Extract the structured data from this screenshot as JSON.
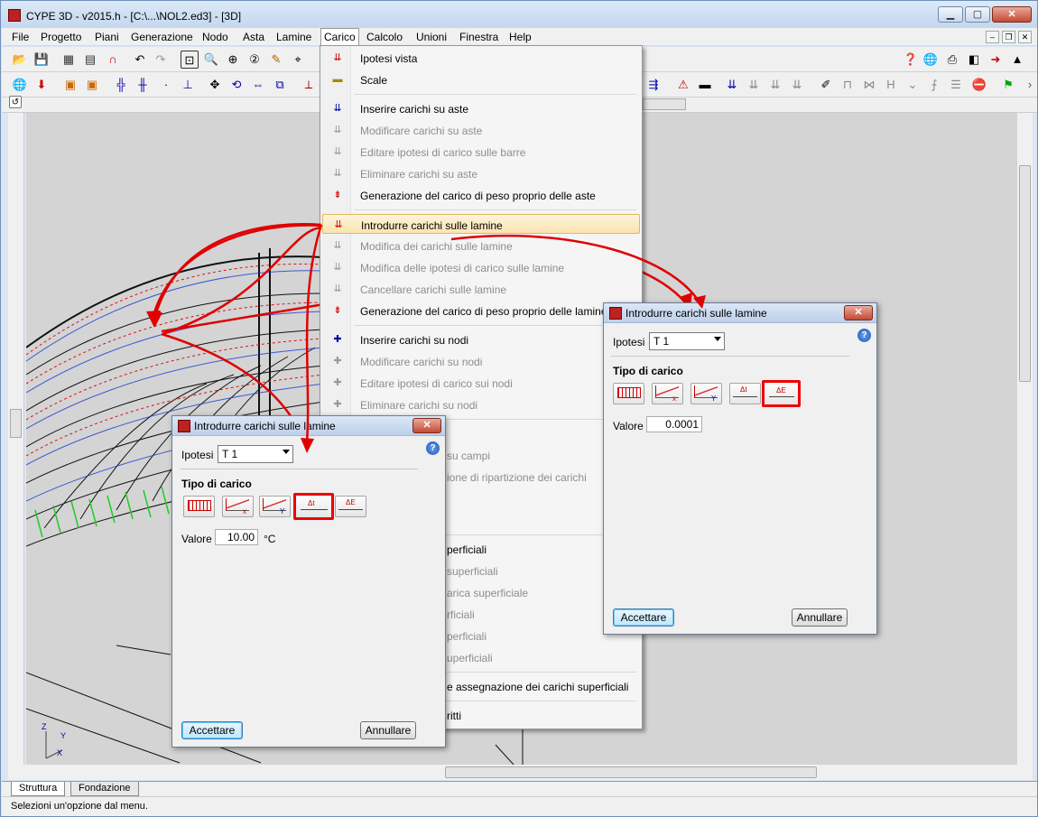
{
  "window": {
    "title": "CYPE 3D - v2015.h - [C:\\...\\NOL2.ed3] - [3D]"
  },
  "menubar": [
    {
      "label": "File"
    },
    {
      "label": "Progetto"
    },
    {
      "label": "Piani"
    },
    {
      "label": "Generazione"
    },
    {
      "label": "Nodo"
    },
    {
      "label": "Asta"
    },
    {
      "label": "Lamine"
    },
    {
      "label": "Carico"
    },
    {
      "label": "Calcolo"
    },
    {
      "label": "Unioni"
    },
    {
      "label": "Finestra"
    },
    {
      "label": "Help"
    }
  ],
  "dropdown": {
    "items": [
      {
        "label": "Ipotesi vista",
        "enabled": true
      },
      {
        "label": "Scale",
        "enabled": true
      },
      {
        "label": "Inserire carichi su aste",
        "enabled": true
      },
      {
        "label": "Modificare carichi su aste",
        "enabled": false
      },
      {
        "label": "Editare ipotesi di carico sulle barre",
        "enabled": false
      },
      {
        "label": "Eliminare carichi su aste",
        "enabled": false
      },
      {
        "label": "Generazione del carico di peso proprio delle aste",
        "enabled": true
      },
      {
        "label": "Introdurre carichi sulle lamine",
        "enabled": true
      },
      {
        "label": "Modifica dei carichi sulle lamine",
        "enabled": false
      },
      {
        "label": "Modifica delle ipotesi di carico sulle lamine",
        "enabled": false
      },
      {
        "label": "Cancellare carichi sulle lamine",
        "enabled": false
      },
      {
        "label": "Generazione del carico di peso proprio delle lamine",
        "enabled": true
      },
      {
        "label": "Inserire carichi su nodi",
        "enabled": true
      },
      {
        "label": "Modificare carichi su nodi",
        "enabled": false
      },
      {
        "label": "Editare ipotesi di carico sui nodi",
        "enabled": false
      },
      {
        "label": "Eliminare carichi su nodi",
        "enabled": false
      },
      {
        "label": "su campi",
        "enabled": false
      },
      {
        "label": "ione di ripartizione dei carichi",
        "enabled": false
      },
      {
        "label": "perficiali",
        "enabled": true
      },
      {
        "label": "superficiali",
        "enabled": false
      },
      {
        "label": "arica superficiale",
        "enabled": false
      },
      {
        "label": "rficiali",
        "enabled": false
      },
      {
        "label": "perficiali",
        "enabled": false
      },
      {
        "label": "uperficiali",
        "enabled": false
      },
      {
        "label": "e assegnazione dei carichi superficiali",
        "enabled": true
      },
      {
        "label": "ritti",
        "enabled": true
      }
    ]
  },
  "dialog_left": {
    "title": "Introdurre carichi sulle lamine",
    "ipotesi_label": "Ipotesi",
    "ipotesi_value": "T 1",
    "tipo_label": "Tipo di carico",
    "buttons": [
      "",
      "x",
      "Y",
      "Δt",
      "ΔE"
    ],
    "valore_label": "Valore",
    "valore_value": "10.00",
    "unit": "°C",
    "accept": "Accettare",
    "cancel": "Annullare"
  },
  "dialog_right": {
    "title": "Introdurre carichi sulle lamine",
    "ipotesi_label": "Ipotesi",
    "ipotesi_value": "T 1",
    "tipo_label": "Tipo di carico",
    "buttons": [
      "",
      "x",
      "Y",
      "Δt",
      "ΔE"
    ],
    "valore_label": "Valore",
    "valore_value": "0.0001",
    "accept": "Accettare",
    "cancel": "Annullare"
  },
  "tabs": [
    {
      "label": "Struttura"
    },
    {
      "label": "Fondazione"
    }
  ],
  "status": "Selezioni un'opzione dal menu.",
  "colors": {
    "highlight": "#fce3b0",
    "annotation": "#e00000"
  }
}
